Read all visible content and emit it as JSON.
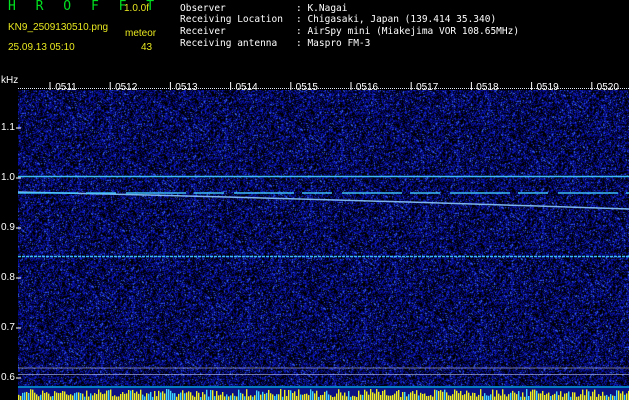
{
  "header": {
    "logo": "H R O F F T",
    "version": "1.0.0f",
    "filename": "KN9_2509130510.png",
    "datetime": "25.09.13 05:10",
    "meteor_label": "meteor",
    "meteor_count": "43"
  },
  "station_info": [
    {
      "label": "Observer",
      "value": ": K.Nagai"
    },
    {
      "label": "Receiving Location",
      "value": ": Chigasaki, Japan (139.414 35.340)"
    },
    {
      "label": "Receiver",
      "value": ": AirSpy mini (Miakejima VOR 108.65MHz)"
    },
    {
      "label": "Receiving antenna",
      "value": ": Maspro FM-3"
    }
  ],
  "chart_data": {
    "type": "heatmap",
    "y_unit": "kHz",
    "y_ticks": [
      "1.1",
      "1.0",
      "0.9",
      "0.8",
      "0.7",
      "0.6"
    ],
    "time_labels": [
      "0511",
      "0512",
      "0513",
      "0514",
      "0515",
      "0516",
      "0517",
      "0518",
      "0519",
      "0520"
    ],
    "traces": [
      {
        "type": "constant",
        "freq_khz": 1.003
      },
      {
        "type": "drift",
        "freq_start_khz": 0.972,
        "freq_end_khz": 0.938
      },
      {
        "type": "constant",
        "freq_khz": 0.97
      },
      {
        "type": "constant",
        "freq_khz": 0.843
      },
      {
        "type": "constant",
        "freq_khz": 0.62
      },
      {
        "type": "constant",
        "freq_khz": 0.607
      }
    ],
    "colors": {
      "noise": "#0a10b0",
      "trace": "#40c8ff",
      "baseline": "#00e8ff",
      "marker": "#f0f020"
    }
  }
}
